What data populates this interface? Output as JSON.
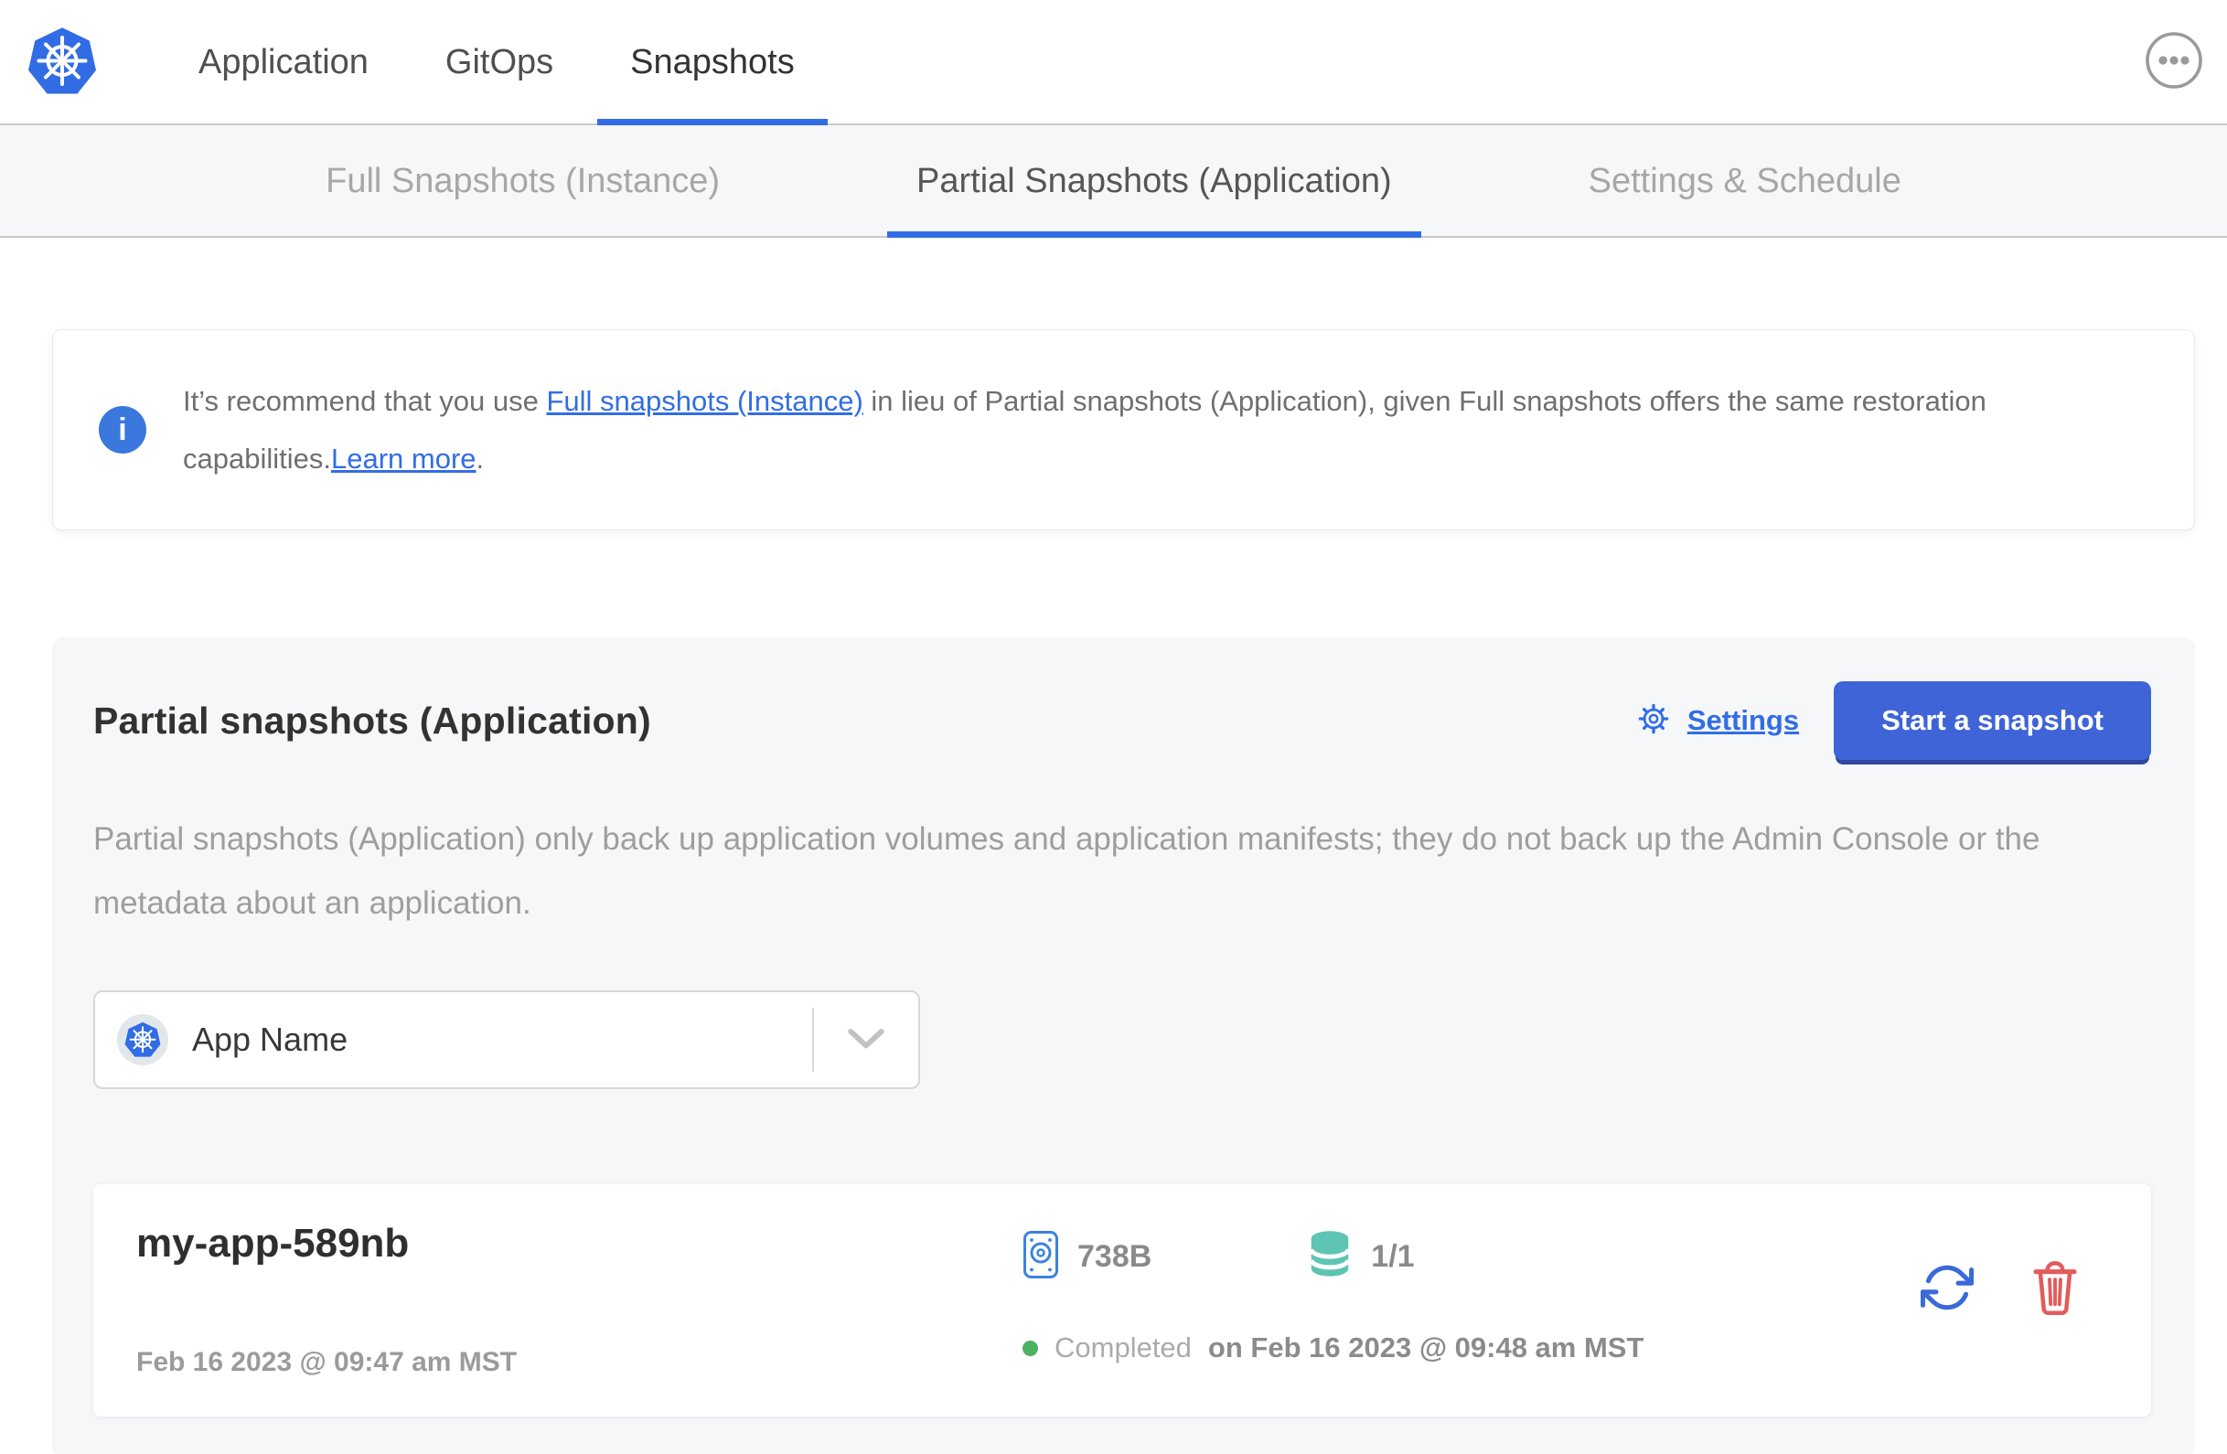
{
  "header": {
    "tabs": [
      {
        "label": "Application"
      },
      {
        "label": "GitOps"
      },
      {
        "label": "Snapshots",
        "active": true
      }
    ]
  },
  "subnav": {
    "tabs": [
      {
        "label": "Full Snapshots (Instance)"
      },
      {
        "label": "Partial Snapshots (Application)",
        "active": true
      },
      {
        "label": "Settings & Schedule"
      }
    ]
  },
  "banner": {
    "info_glyph": "i",
    "text_before_link": "It’s recommend that you use ",
    "link_full_snapshots": "Full snapshots (Instance)",
    "text_middle": " in lieu of Partial snapshots (Application), given Full snapshots offers the same restoration capabilities.",
    "link_learn_more": "Learn more",
    "text_after": "."
  },
  "main": {
    "title": "Partial snapshots (Application)",
    "settings_label": "Settings",
    "start_snapshot_label": "Start a snapshot",
    "description": "Partial snapshots (Application) only back up application volumes and application manifests; they do not back up the Admin Console or the metadata about an application.",
    "app_selector": {
      "value": "App Name"
    },
    "snapshots": [
      {
        "name": "my-app-589nb",
        "started": "Feb 16 2023 @ 09:47 am MST",
        "size": "738B",
        "volumes": "1/1",
        "status": "Completed",
        "finished_prefix": "on",
        "finished": "Feb 16 2023 @ 09:48 am MST"
      }
    ]
  },
  "icons": {
    "logo": "kubernetes-logo",
    "more": "ellipsis-menu-icon",
    "info": "info-icon",
    "settings": "gear-icon",
    "app_selector": "kubernetes-icon",
    "dropdown": "chevron-down-icon",
    "size": "disk-volume-icon",
    "volumes": "database-icon",
    "status": "status-dot",
    "restore": "restore-icon",
    "delete": "trash-icon"
  },
  "colors": {
    "accent_blue": "#326de6",
    "button_blue": "#3f64d7",
    "button_shadow": "#32479f",
    "link_blue": "#326de6",
    "teal": "#5ec4b4",
    "green": "#4db163",
    "red": "#e25c5c",
    "card_bg": "#f5f7f8",
    "subnav_bg": "#f6f7f8"
  }
}
